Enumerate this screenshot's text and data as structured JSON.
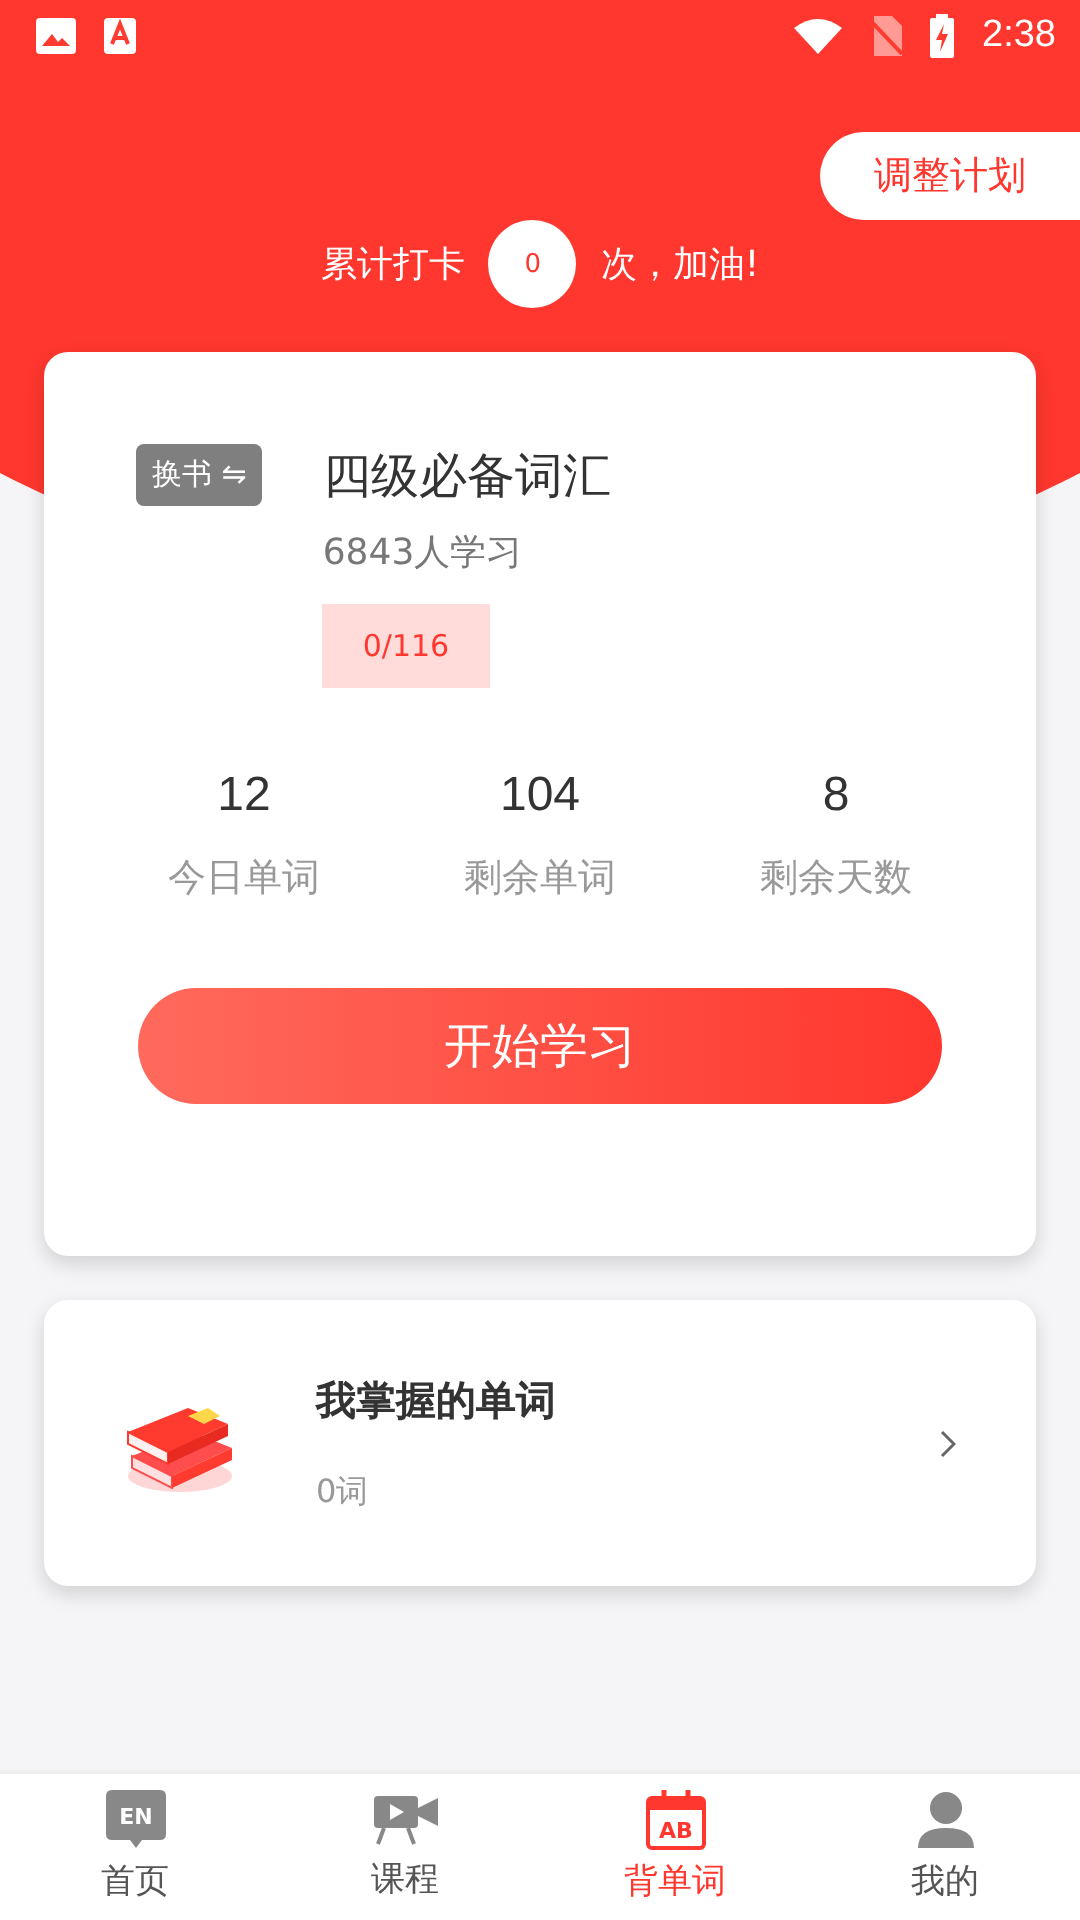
{
  "status_bar": {
    "time": "2:38"
  },
  "plan_button": "调整计划",
  "checkin": {
    "prefix": "累计打卡",
    "count": "0",
    "suffix": "次，加油!"
  },
  "book": {
    "switch_label": "换书 ⇋",
    "title": "四级必备词汇",
    "learners": "6843人学习",
    "progress": "0/116"
  },
  "stats": [
    {
      "value": "12",
      "label": "今日单词"
    },
    {
      "value": "104",
      "label": "剩余单词"
    },
    {
      "value": "8",
      "label": "剩余天数"
    }
  ],
  "start_button": "开始学习",
  "mastered": {
    "title": "我掌握的单词",
    "count": "0词"
  },
  "tabs": [
    {
      "label": "首页",
      "icon_text": "EN",
      "kind": "chat",
      "selected": false
    },
    {
      "label": "课程",
      "kind": "video",
      "selected": false
    },
    {
      "label": "背单词",
      "icon_text": "AB",
      "kind": "calendar",
      "selected": true
    },
    {
      "label": "我的",
      "kind": "person",
      "selected": false
    }
  ]
}
